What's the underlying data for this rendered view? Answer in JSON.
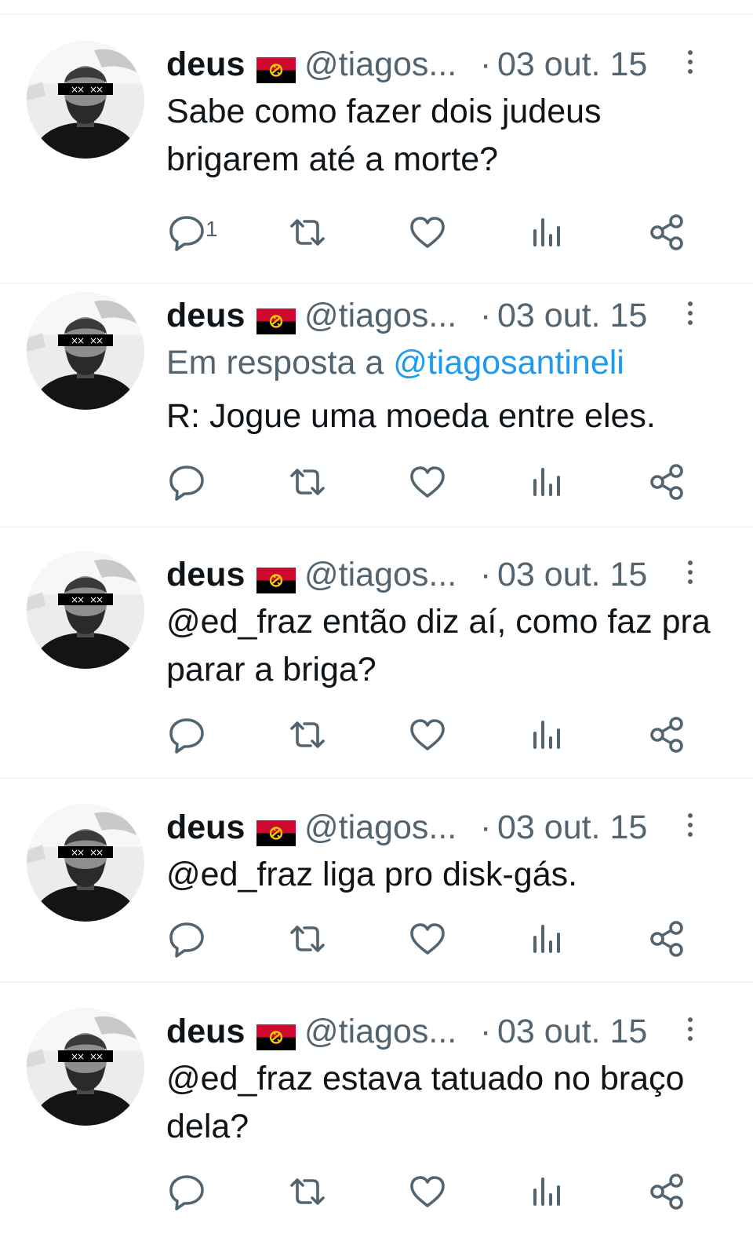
{
  "tweets": [
    {
      "name": "deus",
      "handle": "@tiagos...",
      "dot": "·",
      "date": "03 out. 15",
      "body": "Sabe como fazer dois judeus brigarem até a morte?",
      "reply_count": "1",
      "reply_prefix": "",
      "reply_mention": ""
    },
    {
      "name": "deus",
      "handle": "@tiagos...",
      "dot": "·",
      "date": "03 out. 15",
      "reply_prefix": "Em resposta a ",
      "reply_mention": "@tiagosantineli",
      "body": "R: Jogue uma moeda entre eles.",
      "reply_count": ""
    },
    {
      "name": "deus",
      "handle": "@tiagos...",
      "dot": "·",
      "date": "03 out. 15",
      "body": "@ed_fraz então diz aí, como faz pra parar a briga?",
      "reply_count": "",
      "reply_prefix": "",
      "reply_mention": ""
    },
    {
      "name": "deus",
      "handle": "@tiagos...",
      "dot": "·",
      "date": "03 out. 15",
      "body": "@ed_fraz liga pro disk-gás.",
      "reply_count": "",
      "reply_prefix": "",
      "reply_mention": ""
    },
    {
      "name": "deus",
      "handle": "@tiagos...",
      "dot": "·",
      "date": "03 out. 15",
      "body": "@ed_fraz estava tatuado no braço dela?",
      "reply_count": "",
      "reply_prefix": "",
      "reply_mention": ""
    }
  ],
  "icons": {
    "reply": "reply-icon",
    "retweet": "retweet-icon",
    "like": "heart-icon",
    "views": "views-icon",
    "share": "share-icon",
    "more": "more-vertical-icon",
    "flag": "angola-flag-icon"
  },
  "colors": {
    "text": "#0f1419",
    "muted": "#536471",
    "link": "#1d9bf0",
    "divider": "#eff3f4",
    "flag_red": "#cc092f",
    "flag_black": "#000000",
    "flag_yellow": "#ffcb00"
  }
}
